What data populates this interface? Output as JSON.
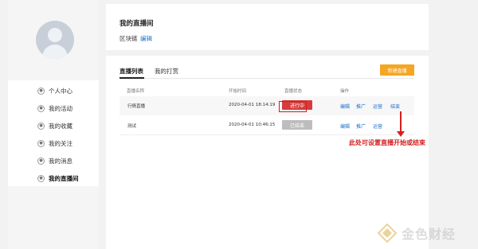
{
  "sidebar": {
    "items": [
      {
        "label": "个人中心"
      },
      {
        "label": "我的活动"
      },
      {
        "label": "我的收藏"
      },
      {
        "label": "我的关注"
      },
      {
        "label": "我的消息"
      },
      {
        "label": "我的直播间",
        "active": true
      }
    ]
  },
  "header": {
    "title": "我的直播间",
    "chain_label": "区块链",
    "edit_label": "编辑"
  },
  "tabs": [
    {
      "label": "直播列表",
      "active": true
    },
    {
      "label": "我的打赏",
      "active": false
    }
  ],
  "new_button_label": "新建直播",
  "table": {
    "headers": [
      "直播名称",
      "开始时间",
      "直播状态",
      "操作"
    ],
    "rows": [
      {
        "name": "行情直播",
        "start": "2020-04-01 18:14:19",
        "status": "进行中",
        "status_color": "#d63c3c",
        "ops": [
          "编辑",
          "推广",
          "运营",
          "结束"
        ]
      },
      {
        "name": "测试",
        "start": "2020-04-01 10:46:15",
        "status": "已结束",
        "status_color": "#bdbdbd",
        "ops": [
          "编辑",
          "推广",
          "运营"
        ]
      }
    ]
  },
  "annotation": {
    "text": "此处可设置直播开始或结束",
    "color": "#d41e1e"
  },
  "watermark": {
    "text": "金色财经"
  },
  "colors": {
    "accent": "#f5a623",
    "link": "#1b6fc9",
    "live": "#d63c3c"
  }
}
